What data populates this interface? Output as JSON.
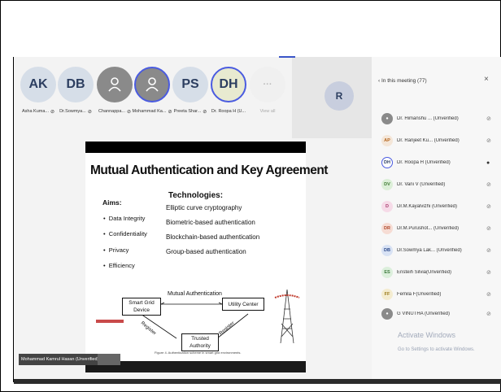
{
  "participants": [
    {
      "initials": "AK",
      "name": "Asha Kuma...",
      "bg": "#d6dee8"
    },
    {
      "initials": "DB",
      "name": "Dr.Sowmya...",
      "bg": "#d6dee8"
    },
    {
      "initials": "",
      "name": "Channappa...",
      "bg": "#8a8a8a"
    },
    {
      "initials": "",
      "name": "Mohammad Ka...",
      "bg": "#8a8a8a"
    },
    {
      "initials": "PS",
      "name": "Preeta Shar...",
      "bg": "#d6dee8"
    },
    {
      "initials": "DH",
      "name": "Dr. Roopa H (U...",
      "bg": "#e8ead0"
    }
  ],
  "view_all": "View all",
  "r_tile": {
    "initials": "R"
  },
  "slide": {
    "title": "Mutual Authentication and Key Agreement",
    "aims_heading": "Aims:",
    "aims": [
      "Data Integrity",
      "Confidentiality",
      "Privacy",
      "Efficiency"
    ],
    "tech_heading": "Technologies:",
    "technologies": [
      "Elliptic curve cryptography",
      "Biometric-based authentication",
      "Blockchain-based authentication",
      "Group-based authentication"
    ],
    "diagram": {
      "device": "Smart Grid Device",
      "utility": "Utility Center",
      "trusted": "Trusted Authority",
      "mutual": "Mutual Authentication",
      "register1": "Register",
      "register2": "Register"
    },
    "caption": "Figure 4. Authentication scheme in smart grid environments."
  },
  "speaker_tag": "Mohammad Kamrul Hasan (Unverified)",
  "panel": {
    "heading": "‹  In this meeting (77)",
    "close": "×",
    "people": [
      {
        "initials": "",
        "name": "Dr. Himanshu ...  (Unverified)",
        "bg": "#8a8a8a",
        "fg": "#ffffff"
      },
      {
        "initials": "AP",
        "name": "Dr. Ranjeet Ku...  (Unverified)",
        "bg": "#f4e6d8",
        "fg": "#b5651d"
      },
      {
        "initials": "DH",
        "name": "Dr. Roopa H (Unverified)",
        "bg": "#ffffff",
        "fg": "#2c3e60"
      },
      {
        "initials": "DV",
        "name": "Dr. Vani V (Unverified)",
        "bg": "#dcefd8",
        "fg": "#3d7a32"
      },
      {
        "initials": "D",
        "name": "Dr.M.Kayalvizhi (Unverified)",
        "bg": "#f6dbe8",
        "fg": "#a83c6e"
      },
      {
        "initials": "DR",
        "name": "Dr.M.Purushot...  (Unverified)",
        "bg": "#f6dcd4",
        "fg": "#b04a2c"
      },
      {
        "initials": "DB",
        "name": "Dr.Sowmya Lak... (Unverified)",
        "bg": "#d8e2f4",
        "fg": "#2c4a8a"
      },
      {
        "initials": "ES",
        "name": "Ensteih Silvia(Unverified)",
        "bg": "#dcefdc",
        "fg": "#3d7a3d"
      },
      {
        "initials": "FF",
        "name": "Femila F(Unverified)",
        "bg": "#f4ecd0",
        "fg": "#9a7a1a"
      },
      {
        "initials": "",
        "name": "G VINUTHA (Unverified)",
        "bg": "#8a8a8a",
        "fg": "#ffffff"
      }
    ],
    "watermark": "Activate Windows",
    "watermark_sub": "Go to Settings to activate Windows."
  }
}
